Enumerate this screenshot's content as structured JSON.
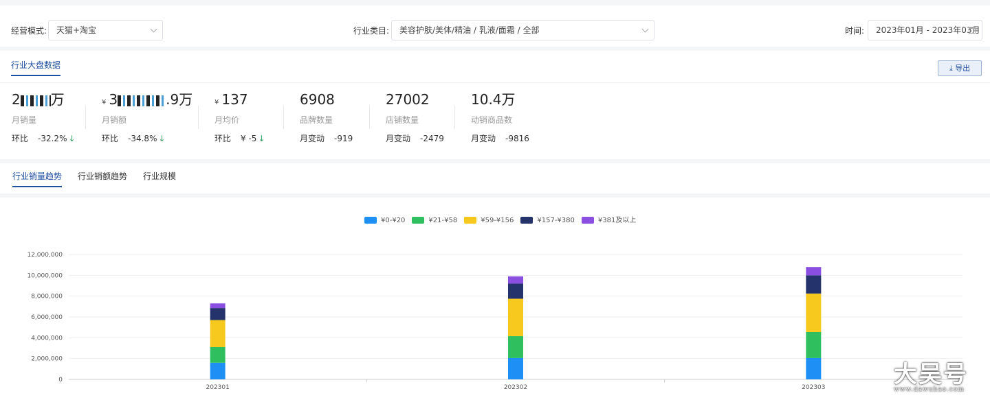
{
  "filters": {
    "mode_label": "经营模式:",
    "mode_value": "天猫+淘宝",
    "category_label": "行业类目:",
    "category_value": "美容护肤/美体/精油 / 乳液/面霜 / 全部",
    "time_label": "时间:",
    "time_value": "2023年01月 - 2023年03月"
  },
  "stats": {
    "section_title": "行业大盘数据",
    "export_label": "导出",
    "export_icon": "download-icon",
    "metrics": [
      {
        "value_prefix": "2",
        "value_suffix": "万",
        "name": "月销量",
        "cmp_label": "环比",
        "cmp_value": "-32.2%",
        "arrow": "↓"
      },
      {
        "yen": "¥",
        "value_prefix": "3",
        "value_suffix": ".9万",
        "name": "月销额",
        "cmp_label": "环比",
        "cmp_value": "-34.8%",
        "arrow": "↓"
      },
      {
        "yen": "¥",
        "value": "137",
        "name": "月均价",
        "cmp_label": "环比",
        "cmp_value": "¥ -5",
        "arrow": "↓"
      },
      {
        "value": "6908",
        "name": "品牌数量",
        "cmp_label": "月变动",
        "cmp_value": "-919"
      },
      {
        "value": "27002",
        "name": "店铺数量",
        "cmp_label": "月变动",
        "cmp_value": "-2479"
      },
      {
        "value": "10.4万",
        "name": "动销商品数",
        "cmp_label": "月变动",
        "cmp_value": "-9816"
      }
    ]
  },
  "tabs": [
    "行业销量趋势",
    "行业销额趋势",
    "行业规模"
  ],
  "colors": {
    "accent": "#1e4fa0",
    "series": [
      "#1e90f5",
      "#2fbf5f",
      "#f7c81e",
      "#24336b",
      "#8a4fe0"
    ]
  },
  "chart_data": {
    "type": "bar",
    "stacked": true,
    "categories": [
      "202301",
      "202302",
      "202303"
    ],
    "series": [
      {
        "name": "¥0-¥20",
        "values": [
          1600000,
          2050000,
          2050000
        ]
      },
      {
        "name": "¥21-¥58",
        "values": [
          1500000,
          2100000,
          2500000
        ]
      },
      {
        "name": "¥59-¥156",
        "values": [
          2600000,
          3600000,
          3700000
        ]
      },
      {
        "name": "¥157-¥380",
        "values": [
          1150000,
          1450000,
          1750000
        ]
      },
      {
        "name": "¥381及以上",
        "values": [
          450000,
          700000,
          800000
        ]
      }
    ],
    "ylim": [
      0,
      12000000
    ],
    "yticks": [
      "0",
      "2,000,000",
      "4,000,000",
      "6,000,000",
      "8,000,000",
      "10,000,000",
      "12,000,000"
    ],
    "grid": true,
    "legend_position": "top"
  },
  "watermark": {
    "big": "大吴号",
    "small": "www.dawuhao.com"
  }
}
